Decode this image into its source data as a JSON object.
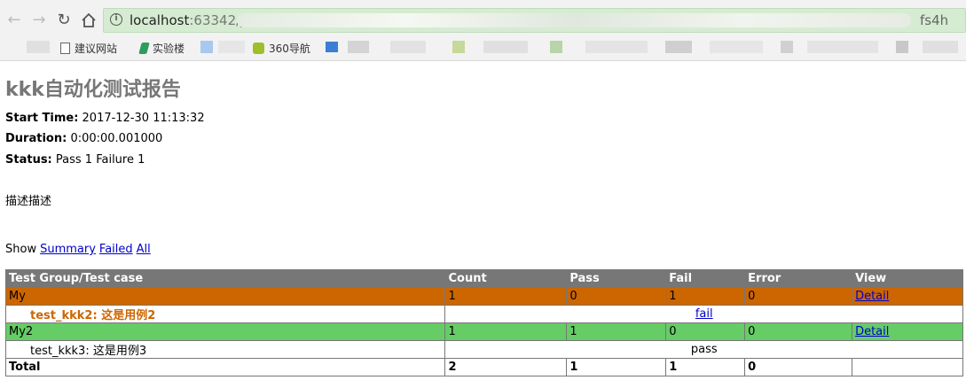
{
  "browser": {
    "url_host": "localhost",
    "url_port": ":63342/jx",
    "url_tail": "fs4h",
    "bookmarks": [
      {
        "label": "建议网站",
        "icon": "page-icon"
      },
      {
        "label": "实验楼",
        "icon": "shiyanlou-icon"
      },
      {
        "label": "360导航",
        "icon": "nav360-icon"
      },
      {
        "label": "",
        "icon": "bookmark-blue-icon"
      }
    ]
  },
  "report": {
    "title": "kkk自动化测试报告",
    "attributes": [
      {
        "name": "Start Time:",
        "value": "2017-12-30 11:13:32"
      },
      {
        "name": "Duration:",
        "value": "0:00:00.001000"
      },
      {
        "name": "Status:",
        "value": "Pass 1 Failure 1"
      }
    ],
    "description": "描述描述",
    "show": {
      "label": "Show",
      "links": [
        "Summary",
        "Failed",
        "All"
      ]
    },
    "table": {
      "headers": [
        "Test Group/Test case",
        "Count",
        "Pass",
        "Fail",
        "Error",
        "View"
      ],
      "groups": [
        {
          "name": "My",
          "count": "1",
          "pass": "0",
          "fail": "1",
          "error": "0",
          "view": "Detail",
          "status": "fail",
          "cases": [
            {
              "name": "test_kkk2: 这是用例2",
              "result": "fail"
            }
          ]
        },
        {
          "name": "My2",
          "count": "1",
          "pass": "1",
          "fail": "0",
          "error": "0",
          "view": "Detail",
          "status": "pass",
          "cases": [
            {
              "name": "test_kkk3: 这是用例3",
              "result": "pass"
            }
          ]
        }
      ],
      "total": {
        "label": "Total",
        "count": "2",
        "pass": "1",
        "fail": "1",
        "error": "0"
      }
    }
  },
  "colors": {
    "fail_row": "#cc6600",
    "pass_row": "#66cc66",
    "header_row": "#777777",
    "title": "#777777"
  }
}
